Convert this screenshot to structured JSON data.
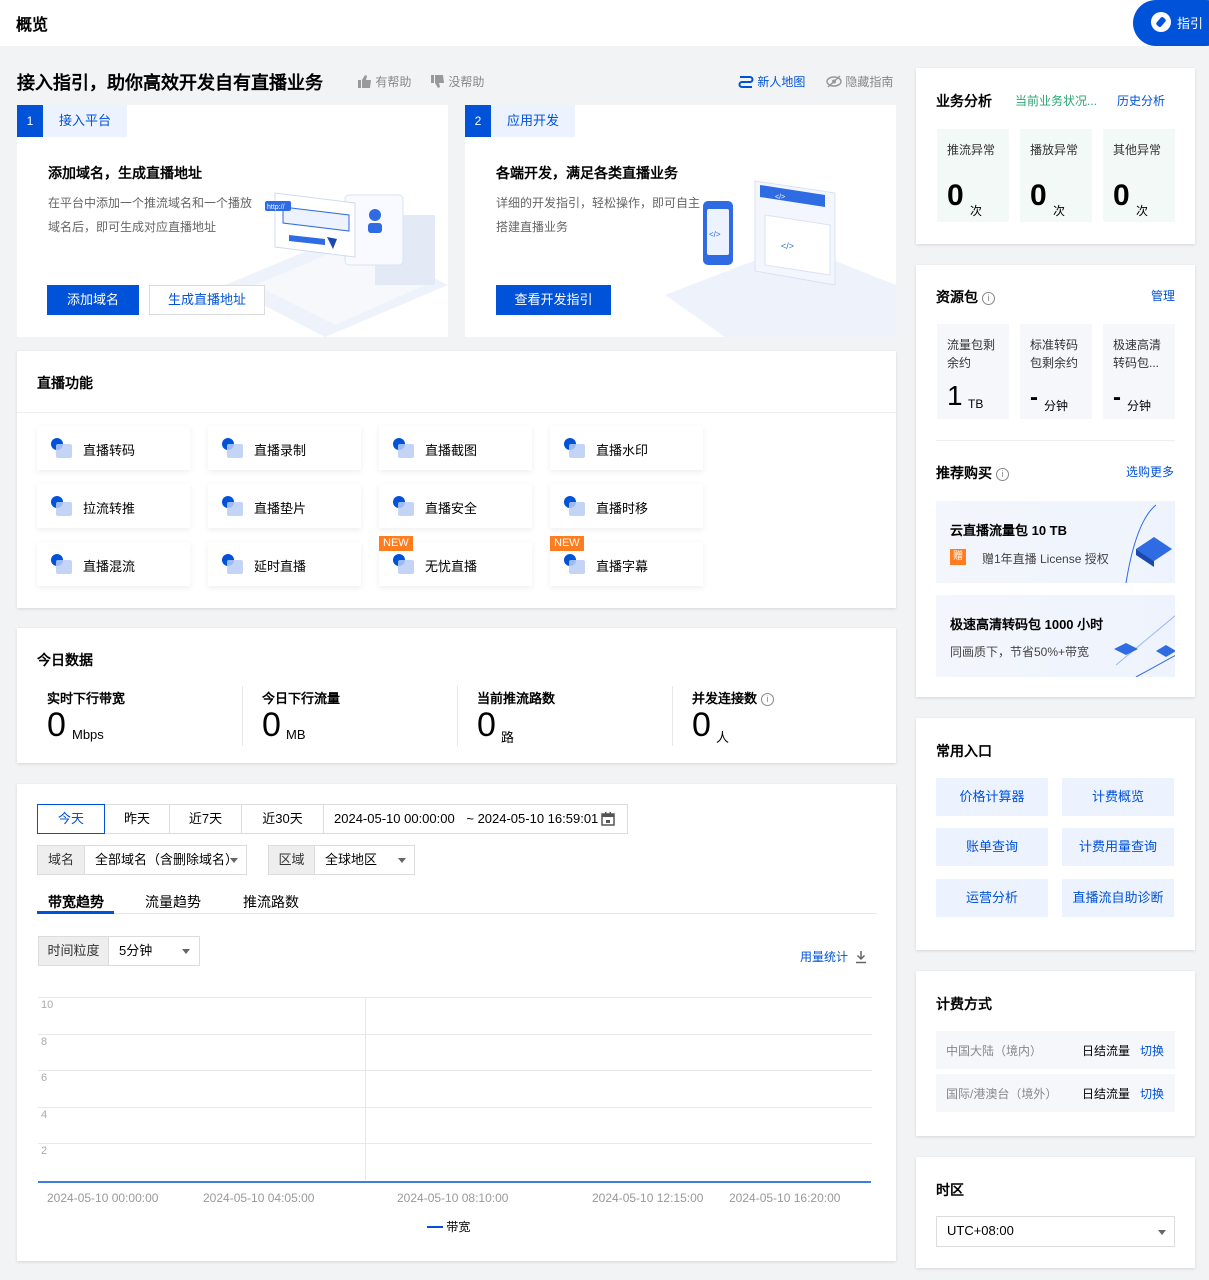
{
  "page_title": "概览",
  "guide_button": "指引",
  "intro": {
    "title": "接入指引，助你高效开发自有直播业务",
    "helpful": "有帮助",
    "not_helpful": "没帮助",
    "new_user_map": "新人地图",
    "hide_guide": "隐藏指南",
    "step1": {
      "num": "1",
      "label": "接入平台",
      "heading": "添加域名，生成直播地址",
      "desc_line1": "在平台中添加一个推流域名和一个播放",
      "desc_line2": "域名后，即可生成对应直播地址",
      "btn_add": "添加域名",
      "btn_gen": "生成直播地址",
      "illus_tag": "http://"
    },
    "step2": {
      "num": "2",
      "label": "应用开发",
      "heading": "各端开发，满足各类直播业务",
      "desc_line1": "详细的开发指引，轻松操作，即可自主",
      "desc_line2": "搭建直播业务",
      "btn_dev": "查看开发指引",
      "illus_code": "</>"
    }
  },
  "features": {
    "title": "直播功能",
    "items": [
      {
        "label": "直播转码",
        "new": false
      },
      {
        "label": "直播录制",
        "new": false
      },
      {
        "label": "直播截图",
        "new": false
      },
      {
        "label": "直播水印",
        "new": false
      },
      {
        "label": "拉流转推",
        "new": false
      },
      {
        "label": "直播垫片",
        "new": false
      },
      {
        "label": "直播安全",
        "new": false
      },
      {
        "label": "直播时移",
        "new": false
      },
      {
        "label": "直播混流",
        "new": false
      },
      {
        "label": "延时直播",
        "new": false
      },
      {
        "label": "无忧直播",
        "new": true
      },
      {
        "label": "直播字幕",
        "new": true
      }
    ],
    "new_badge": "NEW"
  },
  "today": {
    "title": "今日数据",
    "stats": [
      {
        "label": "实时下行带宽",
        "value": "0",
        "unit": "Mbps"
      },
      {
        "label": "今日下行流量",
        "value": "0",
        "unit": "MB"
      },
      {
        "label": "当前推流路数",
        "value": "0",
        "unit": "路"
      },
      {
        "label": "并发连接数",
        "value": "0",
        "unit": "人"
      }
    ]
  },
  "filters": {
    "ranges": [
      "今天",
      "昨天",
      "近7天",
      "近30天"
    ],
    "date_start": "2024-05-10 00:00:00",
    "date_sep": "~",
    "date_end": "2024-05-10 16:59:01",
    "domain_label": "域名",
    "domain_value": "全部域名（含删除域名）",
    "region_label": "区域",
    "region_value": "全球地区"
  },
  "tabs": [
    "带宽趋势",
    "流量趋势",
    "推流路数"
  ],
  "granularity": {
    "label": "时间粒度",
    "value": "5分钟"
  },
  "usage_stats": "用量统计",
  "chart_data": {
    "type": "line",
    "title": "",
    "xlabel": "",
    "ylabel": "",
    "x_ticks": [
      "2024-05-10 00:00:00",
      "2024-05-10 04:05:00",
      "2024-05-10 08:10:00",
      "2024-05-10 12:15:00",
      "2024-05-10 16:20:00"
    ],
    "y_ticks": [
      "10",
      "8",
      "6",
      "4",
      "2"
    ],
    "ylim": [
      0,
      10
    ],
    "series": [
      {
        "name": "带宽",
        "values": [
          0,
          0,
          0,
          0,
          0
        ]
      }
    ],
    "legend_position": "bottom",
    "color": "#0052d9"
  },
  "business": {
    "title": "业务分析",
    "status_link": "当前业务状况...",
    "history_link": "历史分析",
    "items": [
      {
        "label": "推流异常",
        "value": "0",
        "unit": "次"
      },
      {
        "label": "播放异常",
        "value": "0",
        "unit": "次"
      },
      {
        "label": "其他异常",
        "value": "0",
        "unit": "次"
      }
    ]
  },
  "resource": {
    "title": "资源包",
    "manage": "管理",
    "items": [
      {
        "label_line1": "流量包剩",
        "label_line2": "余约",
        "value": "1",
        "unit": "TB"
      },
      {
        "label_line1": "标准转码",
        "label_line2": "包剩余约",
        "value": "-",
        "unit": "分钟"
      },
      {
        "label_line1": "极速高清",
        "label_line2": "转码包...",
        "value": "-",
        "unit": "分钟"
      }
    ]
  },
  "recommend": {
    "title": "推荐购买",
    "more": "选购更多",
    "card1_title": "云直播流量包 10 TB",
    "card1_badge": "赠",
    "card1_desc": "赠1年直播 License 授权",
    "card2_title": "极速高清转码包 1000 小时",
    "card2_desc": "同画质下，节省50%+带宽"
  },
  "entries": {
    "title": "常用入口",
    "items": [
      "价格计算器",
      "计费概览",
      "账单查询",
      "计费用量查询",
      "运营分析",
      "直播流自助诊断"
    ]
  },
  "billing": {
    "title": "计费方式",
    "rows": [
      {
        "region": "中国大陆（境内）",
        "mode": "日结流量",
        "action": "切换"
      },
      {
        "region": "国际/港澳台（境外）",
        "mode": "日结流量",
        "action": "切换"
      }
    ]
  },
  "timezone": {
    "title": "时区",
    "value": "UTC+08:00"
  }
}
